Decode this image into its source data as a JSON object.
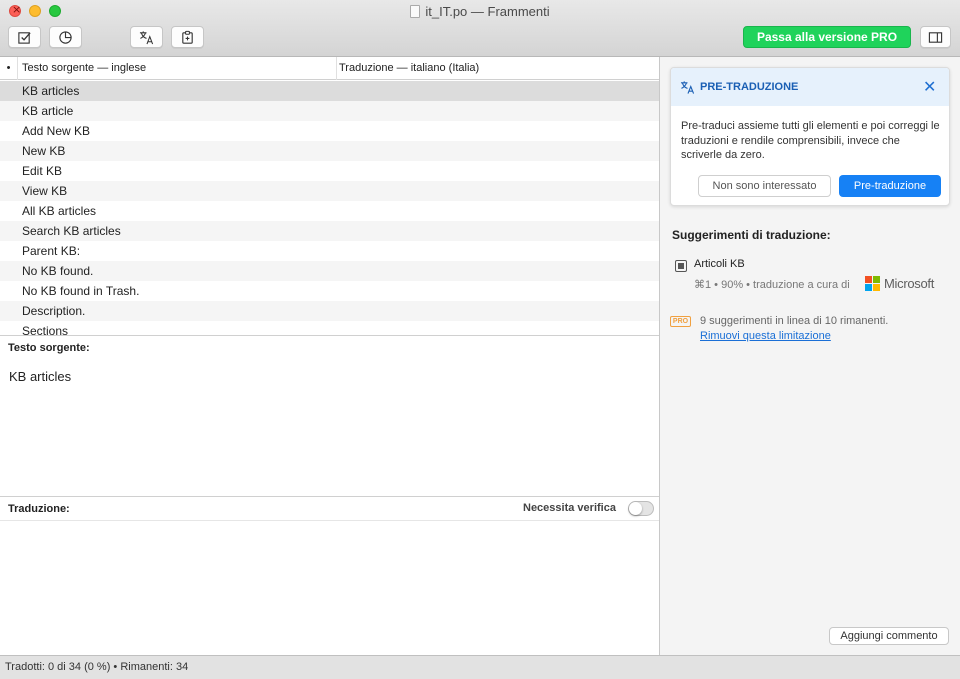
{
  "window": {
    "title": "it_IT.po — Frammenti"
  },
  "toolbar": {
    "pro_label": "Passa alla versione PRO"
  },
  "table": {
    "headers": {
      "marker": "•",
      "source": "Testo sorgente — inglese",
      "target": "Traduzione — italiano (Italia)"
    },
    "rows": [
      "KB articles",
      "KB article",
      "Add New KB",
      "New KB",
      "Edit KB",
      "View KB",
      "All KB articles",
      "Search KB articles",
      "Parent KB:",
      "No KB found.",
      "No KB found in Trash.",
      "Description.",
      "Sections"
    ]
  },
  "source_panel": {
    "label": "Testo sorgente:",
    "text": "KB articles"
  },
  "translation_panel": {
    "label": "Traduzione:",
    "verify_label": "Necessita verifica"
  },
  "pretranslation": {
    "title": "PRE-TRADUZIONE",
    "body": "Pre-traduci assieme tutti gli elementi e poi correggi le traduzioni e rendile comprensibili, invece che scriverle da zero.",
    "decline": "Non sono interessato",
    "accept": "Pre-traduzione"
  },
  "suggestions": {
    "title": "Suggerimenti di traduzione:",
    "item_text": "Articoli KB",
    "item_meta": "⌘1 • 90% • traduzione a cura di",
    "provider": "Microsoft",
    "provider_colors": [
      "#f25022",
      "#7fba00",
      "#00a4ef",
      "#ffb900"
    ]
  },
  "pro_limit": {
    "badge": "PRO",
    "text": "9 suggerimenti in linea di 10 rimanenti.",
    "link": "Rimuovi questa limitazione"
  },
  "add_comment": "Aggiungi commento",
  "status": {
    "text": "Tradotti: 0 di 34 (0 %)  •  Rimanenti: 34"
  }
}
